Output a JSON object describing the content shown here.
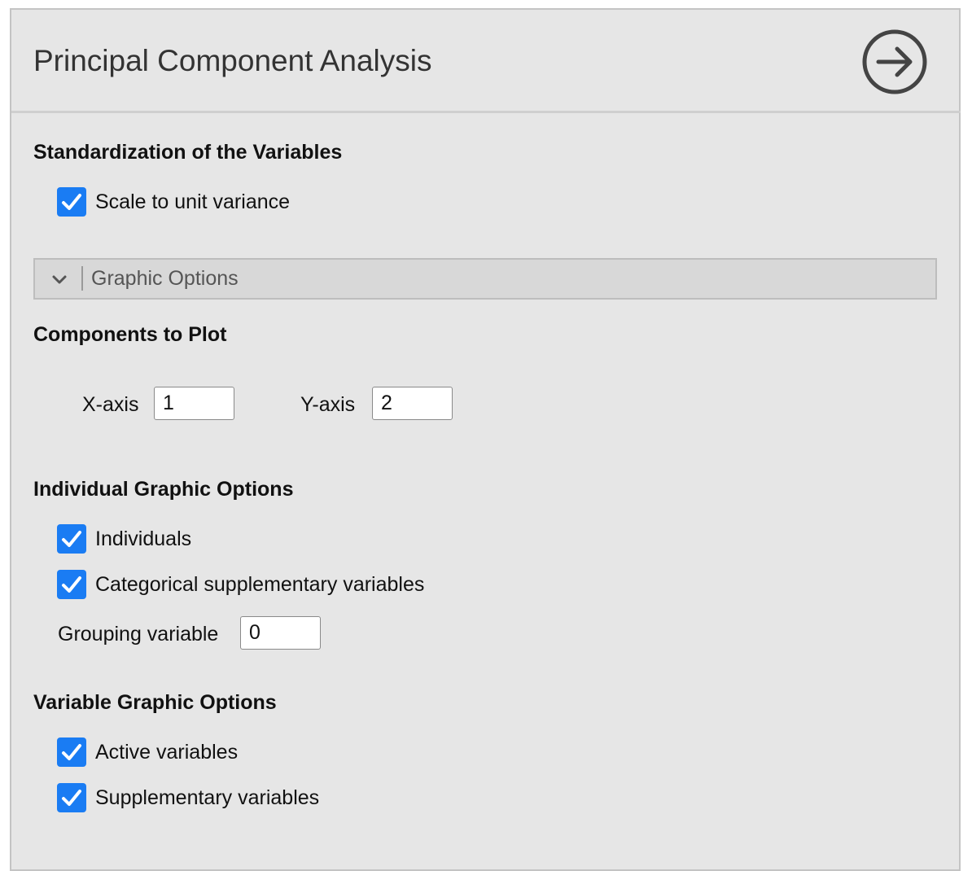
{
  "header": {
    "title": "Principal Component Analysis",
    "run_icon": "arrow-right-circle-icon"
  },
  "standardization": {
    "title": "Standardization of the Variables",
    "scale_label": "Scale to unit variance",
    "scale_checked": true
  },
  "graphic_options": {
    "label": "Graphic Options",
    "expanded": true,
    "icon": "chevron-down-icon"
  },
  "components": {
    "title": "Components to Plot",
    "x_label": "X-axis",
    "x_value": "1",
    "y_label": "Y-axis",
    "y_value": "2"
  },
  "individual": {
    "title": "Individual Graphic Options",
    "individuals_label": "Individuals",
    "individuals_checked": true,
    "categorical_label": "Categorical supplementary variables",
    "categorical_checked": true,
    "grouping_label": "Grouping variable",
    "grouping_value": "0"
  },
  "variable": {
    "title": "Variable Graphic Options",
    "active_label": "Active variables",
    "active_checked": true,
    "supplementary_label": "Supplementary variables",
    "supplementary_checked": true
  },
  "colors": {
    "panel_background": "#e6e6e6",
    "checkbox_accent": "#1a7cf3",
    "collapsible_background": "#d8d8d8"
  }
}
